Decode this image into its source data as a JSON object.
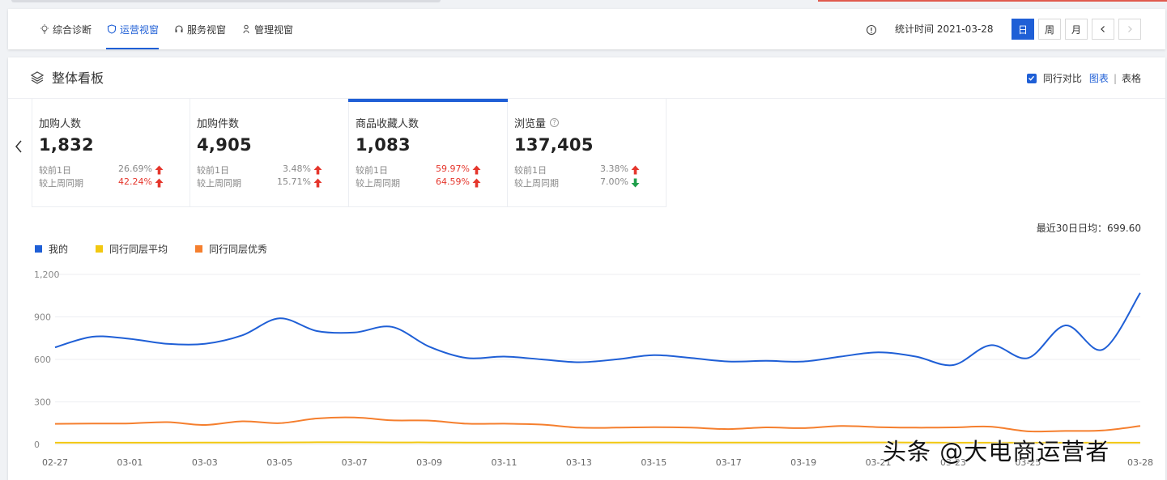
{
  "nav": {
    "tabs": [
      {
        "label": "综合诊断",
        "icon": "bulb-icon",
        "active": false
      },
      {
        "label": "运营视窗",
        "icon": "shield-icon",
        "active": true
      },
      {
        "label": "服务视窗",
        "icon": "headset-icon",
        "active": false
      },
      {
        "label": "管理视窗",
        "icon": "person-icon",
        "active": false
      }
    ],
    "stat_time": "统计时间 2021-03-28",
    "period_day": "日",
    "period_week": "周",
    "period_month": "月",
    "prev_label": "‹",
    "next_label": "›"
  },
  "panel": {
    "title": "整体看板",
    "compare_label": "同行对比",
    "view_chart": "图表",
    "view_sep": "|",
    "view_table": "表格",
    "avg_text": "最近30日日均：699.60"
  },
  "cards": [
    {
      "title": "加购人数",
      "value": "1,832",
      "day_label": "较前1日",
      "day_val": "26.69%",
      "day_dir": "up",
      "day_red": false,
      "week_label": "较上周同期",
      "week_val": "42.24%",
      "week_dir": "up",
      "week_red": true,
      "active": false,
      "help": false
    },
    {
      "title": "加购件数",
      "value": "4,905",
      "day_label": "较前1日",
      "day_val": "3.48%",
      "day_dir": "up",
      "day_red": false,
      "week_label": "较上周同期",
      "week_val": "15.71%",
      "week_dir": "up",
      "week_red": false,
      "active": false,
      "help": false
    },
    {
      "title": "商品收藏人数",
      "value": "1,083",
      "day_label": "较前1日",
      "day_val": "59.97%",
      "day_dir": "up",
      "day_red": true,
      "week_label": "较上周同期",
      "week_val": "64.59%",
      "week_dir": "up",
      "week_red": true,
      "active": true,
      "help": false
    },
    {
      "title": "浏览量",
      "value": "137,405",
      "day_label": "较前1日",
      "day_val": "3.38%",
      "day_dir": "up",
      "day_red": false,
      "week_label": "较上周同期",
      "week_val": "7.00%",
      "week_dir": "down",
      "week_red": false,
      "active": false,
      "help": true
    }
  ],
  "colors": {
    "primary": "#1f5fd6",
    "up": "#e5362c",
    "down": "#1e9e4a"
  },
  "chart_data": {
    "type": "line",
    "ylim": [
      0,
      1200
    ],
    "yticks": [
      "0",
      "300",
      "600",
      "900",
      "1,200"
    ],
    "x": [
      "02-27",
      "02-28",
      "03-01",
      "03-02",
      "03-03",
      "03-04",
      "03-05",
      "03-06",
      "03-07",
      "03-08",
      "03-09",
      "03-10",
      "03-11",
      "03-12",
      "03-13",
      "03-14",
      "03-15",
      "03-16",
      "03-17",
      "03-18",
      "03-19",
      "03-20",
      "03-21",
      "03-22",
      "03-23",
      "03-24",
      "03-25",
      "03-26",
      "03-27",
      "03-28"
    ],
    "xtick_labels": [
      "02-27",
      "03-01",
      "03-03",
      "03-05",
      "03-07",
      "03-09",
      "03-11",
      "03-13",
      "03-15",
      "03-17",
      "03-19",
      "03-21",
      "03-23",
      "03-25",
      "03-28"
    ],
    "series": [
      {
        "name": "我的",
        "color": "#1f5fd6",
        "values": [
          685,
          760,
          745,
          710,
          710,
          770,
          890,
          800,
          790,
          830,
          690,
          610,
          620,
          600,
          580,
          600,
          630,
          610,
          585,
          590,
          585,
          620,
          650,
          620,
          560,
          700,
          610,
          840,
          670,
          1070
        ]
      },
      {
        "name": "同行同层平均",
        "color": "#f2c811",
        "values": [
          12,
          12,
          12,
          12,
          13,
          13,
          14,
          15,
          15,
          14,
          14,
          13,
          13,
          13,
          13,
          13,
          14,
          13,
          13,
          13,
          13,
          13,
          14,
          13,
          12,
          12,
          12,
          12,
          12,
          12
        ]
      },
      {
        "name": "同行同层优秀",
        "color": "#f57f2e",
        "values": [
          145,
          147,
          148,
          157,
          137,
          163,
          150,
          183,
          190,
          170,
          168,
          146,
          146,
          140,
          118,
          118,
          122,
          118,
          108,
          120,
          115,
          130,
          122,
          118,
          120,
          125,
          92,
          95,
          98,
          130
        ]
      }
    ]
  },
  "watermark": "头条 @大电商运营者"
}
